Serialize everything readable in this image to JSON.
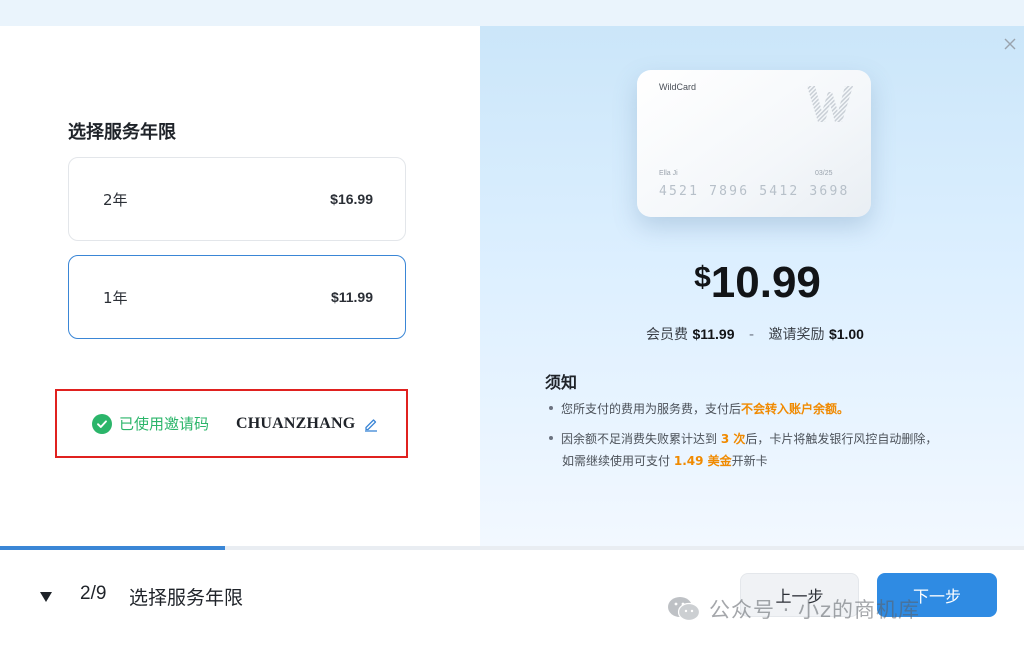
{
  "plan_panel": {
    "title": "选择服务年限",
    "options": [
      {
        "label": "2年",
        "price": "$16.99",
        "selected": false
      },
      {
        "label": "1年",
        "price": "$11.99",
        "selected": true
      }
    ]
  },
  "invite": {
    "status_label": "已使用邀请码",
    "code": "CHUANZHANG"
  },
  "card": {
    "brand": "WildCard",
    "logo_letter": "W",
    "holder": "Ella Ji",
    "expiry": "03/25",
    "number": "4521 7896 5412 3698"
  },
  "summary": {
    "currency": "$",
    "amount": "10.99",
    "fee_label": "会员费",
    "fee_value": "$11.99",
    "separator": "-",
    "reward_label": "邀请奖励",
    "reward_value": "$1.00"
  },
  "notice": {
    "title": "须知",
    "item1_pre": "您所支付的费用为服务费，支付后",
    "item1_hl": "不会转入账户余额。",
    "item2_pre": "因余额不足消费失败累计达到",
    "item2_hl": "3 次",
    "item2_post": "后，卡片将触发银行风控自动删除，",
    "item2b_pre": "如需继续使用可支付",
    "item2b_hl": "1.49 美金",
    "item2b_post": "开新卡"
  },
  "footer": {
    "step_count": "2/9",
    "step_label": "选择服务年限",
    "progress": 0.22,
    "prev_label": "上一步",
    "next_label": "下一步"
  },
  "watermark": {
    "text": "公众号 · 小z的商机库"
  },
  "colors": {
    "accent": "#2f8be3",
    "success": "#2bb56a",
    "highlight": "#f08a00",
    "annotation_red": "#e0211f"
  },
  "icons": [
    "check-circle-icon",
    "pencil-icon",
    "close-icon",
    "caret-down-icon",
    "wechat-icon"
  ]
}
